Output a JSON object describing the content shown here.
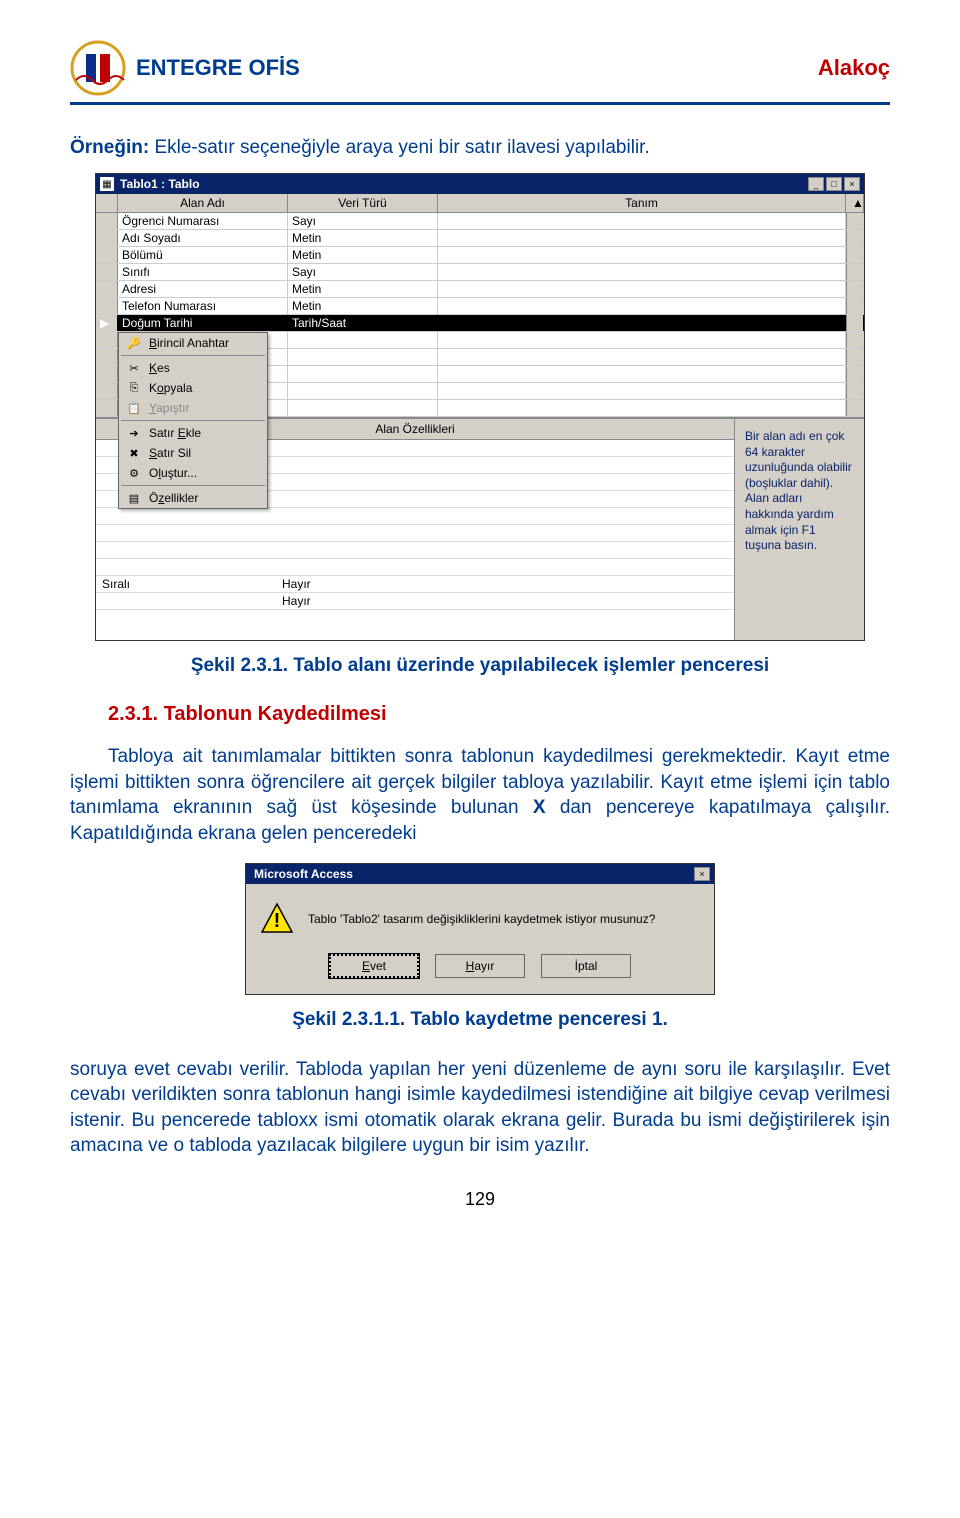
{
  "header": {
    "brand": "ENTEGRE OFİS",
    "author": "Alakoç"
  },
  "intro_bold": "Örneğin:",
  "intro_rest": " Ekle-satır seçeneğiyle araya yeni bir satır ilavesi yapılabilir.",
  "caption1": "Şekil 2.3.1. Tablo alanı üzerinde yapılabilecek işlemler penceresi",
  "section_title": "2.3.1. Tablonun Kaydedilmesi",
  "para1_a": "Tabloya ait tanımlamalar bittikten sonra tablonun kaydedilmesi gerekmektedir. Kayıt etme işlemi bittikten sonra öğrencilere ait gerçek bilgiler tabloya yazılabilir. Kayıt etme işlemi için tablo tanımlama ekranının sağ üst köşesinde bulunan ",
  "para1_b": "X",
  "para1_c": " dan pencereye kapatılmaya çalışılır. Kapatıldığında ekrana gelen penceredeki",
  "caption2": "Şekil 2.3.1.1. Tablo kaydetme penceresi 1.",
  "para2": "soruya evet cevabı verilir. Tabloda yapılan her yeni düzenleme de aynı soru ile karşılaşılır. Evet cevabı verildikten sonra tablonun hangi isimle kaydedilmesi istendiğine ait bilgiye cevap verilmesi istenir. Bu pencerede tabloxx ismi otomatik olarak ekrana gelir. Burada bu ismi değiştirilerek işin amacına ve o tabloda yazılacak bilgilere uygun bir isim yazılır.",
  "page_number": "129",
  "shot1": {
    "title": "Tablo1 : Tablo",
    "columns": {
      "c1": "Alan Adı",
      "c2": "Veri Türü",
      "c3": "Tanım"
    },
    "rows": [
      {
        "name": "Ögrenci Numarası",
        "type": "Sayı"
      },
      {
        "name": "Adı Soyadı",
        "type": "Metin"
      },
      {
        "name": "Bölümü",
        "type": "Metin"
      },
      {
        "name": "Sınıfı",
        "type": "Sayı"
      },
      {
        "name": "Adresi",
        "type": "Metin"
      },
      {
        "name": "Telefon Numarası",
        "type": "Metin"
      },
      {
        "name": "Doğum Tarihi",
        "type": "Tarih/Saat"
      }
    ],
    "context_menu": [
      {
        "label": "Birincil Anahtar",
        "icon": "key",
        "u": "B"
      },
      {
        "sep": true
      },
      {
        "label": "Kes",
        "icon": "cut",
        "u": "K"
      },
      {
        "label": "Kopyala",
        "icon": "copy",
        "u": "o"
      },
      {
        "label": "Yapıştır",
        "icon": "paste",
        "u": "Y",
        "disabled": true
      },
      {
        "sep": true
      },
      {
        "label": "Satır Ekle",
        "icon": "insert-row",
        "u": "E"
      },
      {
        "label": "Satır Sil",
        "icon": "delete-row",
        "u": "S"
      },
      {
        "label": "Oluştur...",
        "icon": "build",
        "u": "l"
      },
      {
        "sep": true
      },
      {
        "label": "Özellikler",
        "icon": "properties",
        "u": "z"
      }
    ],
    "props_header": "Alan Özellikleri",
    "props": [
      {
        "label": "Sıralı",
        "value": "Hayır"
      },
      {
        "label": "",
        "value": "Hayır"
      }
    ],
    "hint": "Bir alan adı en çok 64 karakter uzunluğunda olabilir (boşluklar dahil). Alan adları hakkında yardım almak için F1 tuşuna basın."
  },
  "shot2": {
    "title": "Microsoft Access",
    "message": "Tablo 'Tablo2' tasarım değişikliklerini kaydetmek istiyor musunuz?",
    "buttons": {
      "yes": "Evet",
      "no": "Hayır",
      "cancel": "İptal"
    }
  }
}
